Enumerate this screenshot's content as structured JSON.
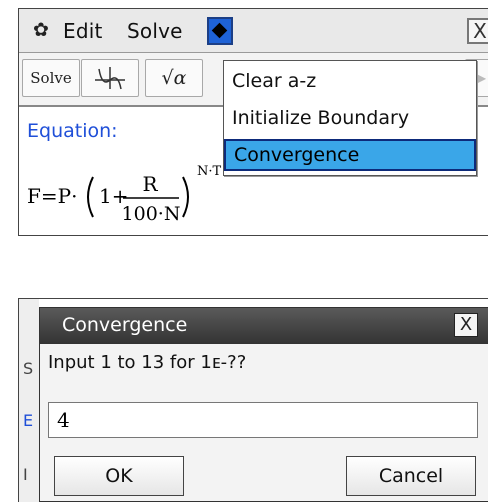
{
  "screen1": {
    "menubar": {
      "gear_icon": "gear-icon",
      "edit_label": "Edit",
      "solve_label": "Solve",
      "diamond_icon": "diamond-icon",
      "close_label": "X"
    },
    "toolbar": {
      "solve_label": "Solve",
      "sqrt_label": "√α",
      "arrow_label": "▶"
    },
    "workarea": {
      "equation_label": "Equation:",
      "formula": {
        "lhs": "F=P·",
        "one_plus": "1+",
        "numerator": "R",
        "denominator": "100·N",
        "exponent": "N·T"
      }
    },
    "dropdown": {
      "items": [
        "Clear a-z",
        "Initialize Boundary",
        "Convergence"
      ],
      "selected_index": 2,
      "highlight_color": "#3aa6e8"
    }
  },
  "screen2": {
    "background_fragments": [
      "S",
      "E",
      "I"
    ],
    "dialog": {
      "title": "Convergence",
      "close_label": "X",
      "prompt": "Input 1 to 13 for 1ᴇ-??",
      "input_value": "4",
      "ok_label": "OK",
      "cancel_label": "Cancel"
    }
  },
  "colors": {
    "accent_blue": "#1f4fd8",
    "menu_highlight": "#3aa6e8",
    "dialog_title_bg": "#3f3f3f"
  }
}
